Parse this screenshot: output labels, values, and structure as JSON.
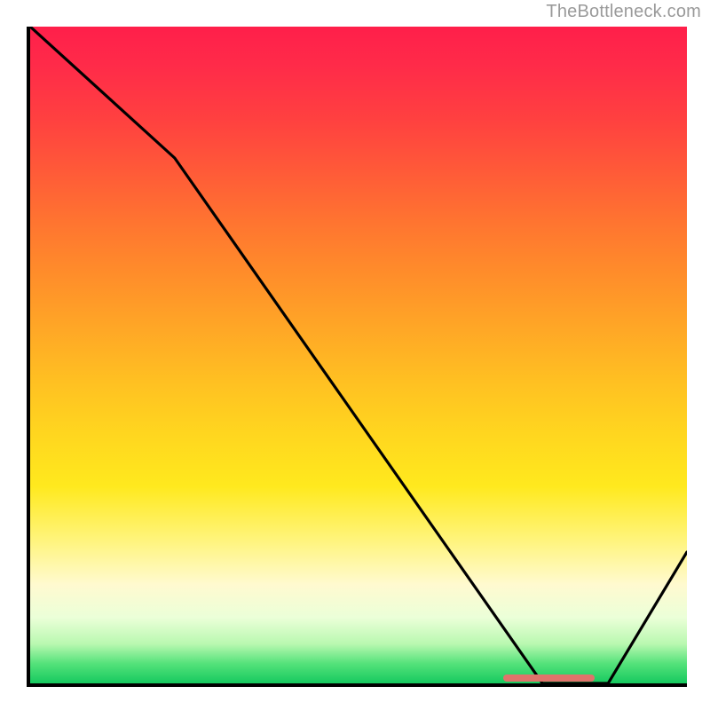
{
  "attribution": "TheBottleneck.com",
  "chart_data": {
    "type": "line",
    "title": "",
    "xlabel": "",
    "ylabel": "",
    "xlim": [
      0,
      100
    ],
    "ylim": [
      0,
      100
    ],
    "series": [
      {
        "name": "curve",
        "x": [
          0,
          22,
          78,
          88,
          100
        ],
        "y": [
          100,
          80,
          0,
          0,
          20
        ]
      }
    ],
    "optimum_marker": {
      "x_start": 72,
      "x_end": 86,
      "y": 0
    },
    "background": "heat-gradient"
  }
}
